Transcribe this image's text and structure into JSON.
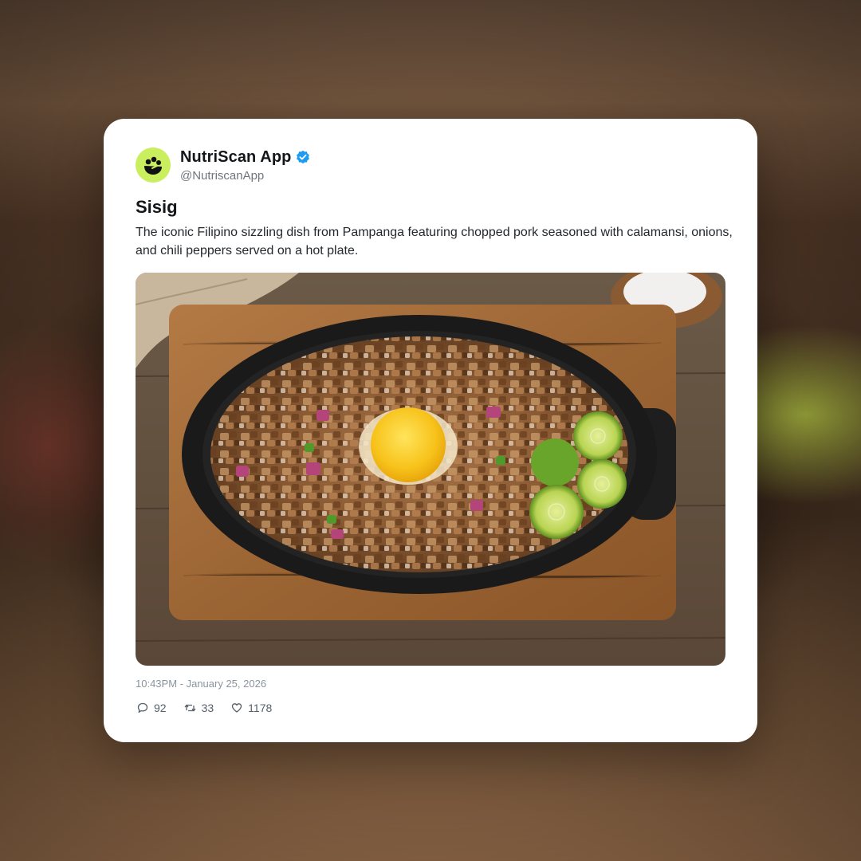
{
  "post": {
    "display_name": "NutriScan App",
    "handle": "@NutriscanApp",
    "verified": true,
    "title": "Sisig",
    "body": "The iconic Filipino sizzling dish from Pampanga featuring chopped pork seasoned with calamansi, onions, and chili peppers served on a hot plate.",
    "timestamp": "10:43PM - January 25, 2026",
    "stats": {
      "replies": "92",
      "reposts": "33",
      "likes": "1178"
    }
  },
  "icons": {
    "avatar": "nutriscan-logo-icon",
    "verified": "verified-badge-icon",
    "replies": "comment-icon",
    "reposts": "repost-icon",
    "likes": "heart-icon"
  },
  "colors": {
    "avatar_bg": "#c9ef5e",
    "verified_blue": "#1d9bf0",
    "card_bg": "#ffffff"
  }
}
